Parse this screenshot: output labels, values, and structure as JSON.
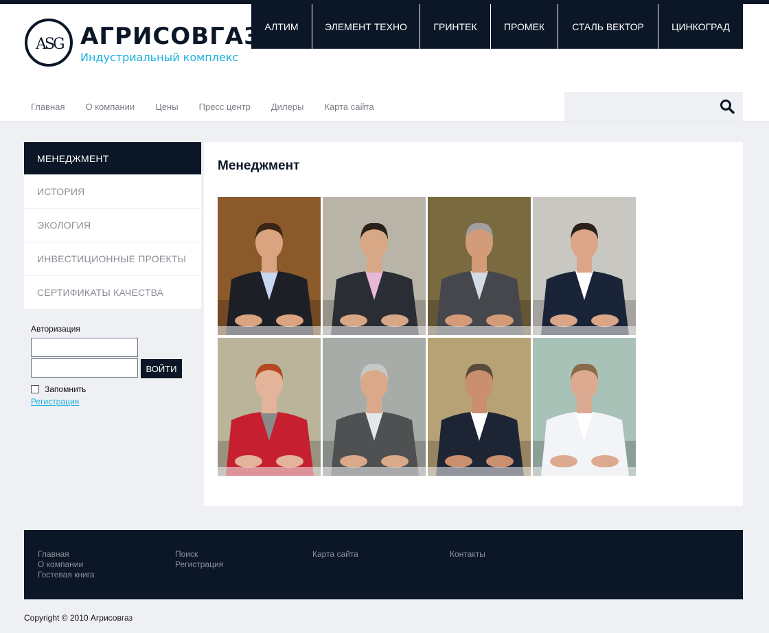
{
  "brand": {
    "logo_mark_letters": "ASG",
    "title": "АГРИСОВГАЗ",
    "subtitle": "Индустриальный комплекс"
  },
  "brand_nav": [
    {
      "label": "АЛТИМ"
    },
    {
      "label": "ЭЛЕМЕНТ ТЕХНО"
    },
    {
      "label": "ГРИНТЕК"
    },
    {
      "label": "ПРОМЕК"
    },
    {
      "label": "СТАЛЬ ВЕКТОР"
    },
    {
      "label": "ЦИНКОГРАД"
    }
  ],
  "main_nav": [
    {
      "label": "Главная"
    },
    {
      "label": "О компании"
    },
    {
      "label": "Цены"
    },
    {
      "label": "Пресс центр"
    },
    {
      "label": "Дилеры"
    },
    {
      "label": "Карта сайта"
    }
  ],
  "search": {
    "placeholder": "",
    "value": "",
    "icon": "search-icon"
  },
  "sidebar": {
    "items": [
      {
        "label": "МЕНЕДЖМЕНТ",
        "active": true
      },
      {
        "label": "ИСТОРИЯ"
      },
      {
        "label": "ЭКОЛОГИЯ"
      },
      {
        "label": "ИНВЕСТИЦИОННЫЕ ПРОЕКТЫ"
      },
      {
        "label": "СЕРТИФИКАТЫ КАЧЕСТВА"
      }
    ]
  },
  "auth": {
    "title": "Авторизация",
    "login_value": "",
    "password_value": "",
    "login_button": "ВОЙТИ",
    "remember_label": "Запомнить",
    "register_link": "Регистрация"
  },
  "content": {
    "title": "Менеджмент",
    "photos": [
      {
        "bg": "#8a5a2a",
        "suit": "#1d1f26",
        "shirt": "#c8d8f0",
        "skin": "#d9a47f",
        "hair": "#3a2414"
      },
      {
        "bg": "#b8b4a8",
        "suit": "#2a2d33",
        "shirt": "#e8b7d8",
        "skin": "#d8a785",
        "hair": "#2c2118"
      },
      {
        "bg": "#7a6a40",
        "suit": "#45474c",
        "shirt": "#d5dbe5",
        "skin": "#d49b78",
        "hair": "#a0a0a0"
      },
      {
        "bg": "#c9c7c2",
        "suit": "#1a2438",
        "shirt": "#ffffff",
        "skin": "#dba688",
        "hair": "#2b2118"
      },
      {
        "bg": "#b9b49a",
        "suit": "#c62030",
        "shirt": "#8a8a8a",
        "skin": "#e4b49a",
        "hair": "#b54a22"
      },
      {
        "bg": "#a8aca8",
        "suit": "#4e5052",
        "shirt": "#e4e6ea",
        "skin": "#d9a989",
        "hair": "#c8c8c8"
      },
      {
        "bg": "#b7a276",
        "suit": "#1d2535",
        "shirt": "#ffffff",
        "skin": "#c98f6f",
        "hair": "#5a4a3a"
      },
      {
        "bg": "#a9c2b8",
        "suit": "#f2f4f7",
        "shirt": "#ffffff",
        "skin": "#dcaa90",
        "hair": "#8a6a48"
      }
    ]
  },
  "footer": {
    "col1": [
      "Главная",
      "О компании",
      "Гостевая книга"
    ],
    "col2": [
      "Поиск",
      "Регистрация"
    ],
    "col3": [
      "Карта сайта"
    ],
    "col4": [
      "Контакты"
    ]
  },
  "copyright": "Copyright © 2010 Агрисовгаз",
  "colors": {
    "accent": "#1ab0de",
    "dark": "#0b1727",
    "bg": "#eef0f4"
  }
}
